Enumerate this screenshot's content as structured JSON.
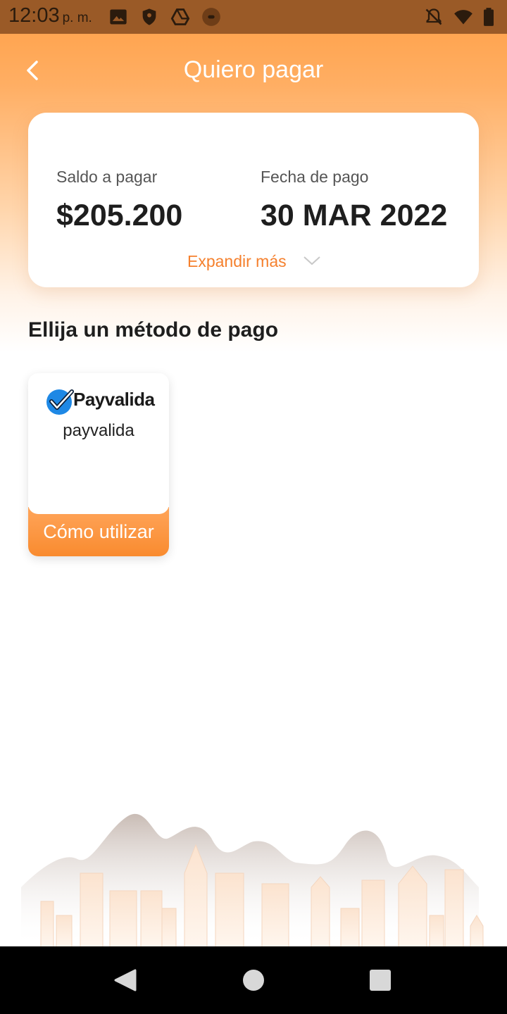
{
  "status_bar": {
    "time": "12:03",
    "ampm": "p. m."
  },
  "header": {
    "title": "Quiero pagar"
  },
  "summary": {
    "balance_label": "Saldo a pagar",
    "balance_value": "$205.200",
    "date_label": "Fecha de pago",
    "date_value": "30 MAR 2022",
    "expand_label": "Expandir más"
  },
  "methods": {
    "section_title": "Ellija un método de pago",
    "items": [
      {
        "logo_text": "Payvalida",
        "name": "payvalida",
        "action_label": "Cómo utilizar"
      }
    ]
  },
  "colors": {
    "accent": "#f5802d",
    "header_gradient_top": "#ff9f45",
    "status_bar": "#9a5a27"
  },
  "icons": {
    "status": [
      "image-icon",
      "shield-icon",
      "drive-icon",
      "record-icon",
      "bell-off-icon",
      "wifi-icon",
      "battery-icon"
    ],
    "nav": [
      "back-triangle-icon",
      "home-circle-icon",
      "recents-square-icon"
    ]
  }
}
